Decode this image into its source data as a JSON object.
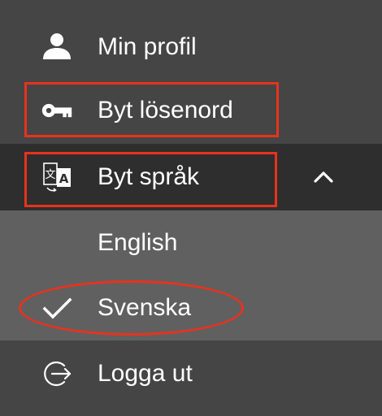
{
  "menu": {
    "profile_label": "Min profil",
    "password_label": "Byt lösenord",
    "language_label": "Byt språk",
    "language_options": [
      {
        "label": "English",
        "selected": false
      },
      {
        "label": "Svenska",
        "selected": true
      }
    ],
    "logout_label": "Logga ut"
  },
  "icons": {
    "profile": "person-icon",
    "password": "key-icon",
    "language": "translate-icon",
    "expand": "chevron-up-icon",
    "selected": "checkmark-icon",
    "logout": "logout-icon"
  },
  "colors": {
    "background": "#454545",
    "active_row": "#2e2e2e",
    "submenu": "#606060",
    "text": "#ffffff",
    "annotation": "#e8321e"
  }
}
